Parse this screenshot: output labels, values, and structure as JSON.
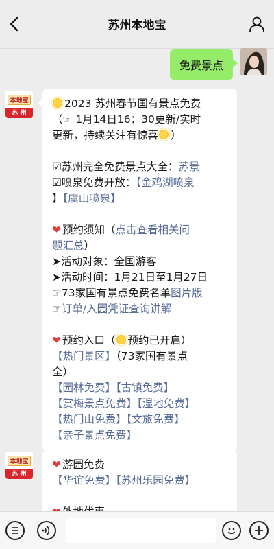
{
  "header": {
    "title": "苏州本地宝"
  },
  "user_message": {
    "text": "免费景点"
  },
  "brand": {
    "logo_text": "本地宝",
    "city": "苏 州"
  },
  "message1": {
    "l1_text": "2023 苏州春节国有景点免费",
    "l2": "（☞ 1月14日16：30更新/实时",
    "l3a": "更新，持续关注有惊喜",
    "l3b": "）",
    "l4a": "☑苏州完全免费景点大全：",
    "l4b": "苏景",
    "l5a": "☑喷泉免费开放：",
    "l5b": "【金鸡湖喷泉",
    "l6a": "】",
    "l6b": "【虞山喷泉】",
    "l7a": "预约须知（",
    "l7b": "点击查看相关问",
    "l8a": "题汇总",
    "l8b": "）",
    "l9": "➤活动对象：全国游客",
    "l10": "➤活动时间：1月21日至1月27日",
    "l11a": "☞73家国有景点免费名单",
    "l11b": "图片版",
    "l12a": "☞",
    "l12b": "订单/入园凭证查询讲解",
    "l13a": "预约入口（",
    "l13b": "预约已开启）",
    "l14a": "【热门景区】",
    "l14b": "（73家国有景点",
    "l15": "全）",
    "l16a": "【园林免费】",
    "l16b": "【古镇免费】",
    "l17a": "【赏梅景点免费】",
    "l17b": "【湿地免费】",
    "l18a": "【热门山免费】",
    "l18b": "【文旅免费】",
    "l19": "【亲子景点免费】"
  },
  "message2": {
    "l1": "游园免费",
    "l2a": "【华谊免费】",
    "l2b": "【苏州乐园免费】",
    "l3": "外地优惠"
  },
  "icons": {
    "back": "chevron-left-icon",
    "profile": "person-icon",
    "menu": "list-icon",
    "voice": "voice-icon",
    "emoji": "emoji-icon",
    "plus": "plus-icon"
  },
  "colors": {
    "link": "#576b95",
    "sent_bubble": "#95ec69",
    "brand_red": "#d8262c"
  }
}
